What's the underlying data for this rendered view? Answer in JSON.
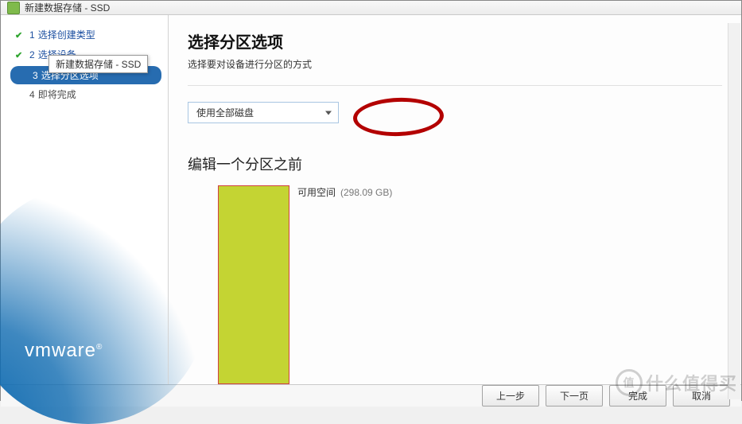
{
  "window": {
    "title": "新建数据存储 - SSD"
  },
  "tooltip": "新建数据存储 - SSD",
  "steps": [
    {
      "num": "1",
      "label": "选择创建类型",
      "state": "completed"
    },
    {
      "num": "2",
      "label": "选择设备",
      "state": "completed"
    },
    {
      "num": "3",
      "label": "选择分区选项",
      "state": "active"
    },
    {
      "num": "4",
      "label": "即将完成",
      "state": "future"
    }
  ],
  "logo": "vmware",
  "content": {
    "heading": "选择分区选项",
    "subtitle": "选择要对设备进行分区的方式",
    "dropdown": {
      "selected": "使用全部磁盘"
    },
    "sectionTitle": "编辑一个分区之前",
    "partition": {
      "label": "可用空间",
      "size": "(298.09 GB)"
    }
  },
  "footer": {
    "back": "上一步",
    "next": "下一页",
    "finish": "完成",
    "cancel": "取消"
  },
  "watermark": "什么值得买"
}
